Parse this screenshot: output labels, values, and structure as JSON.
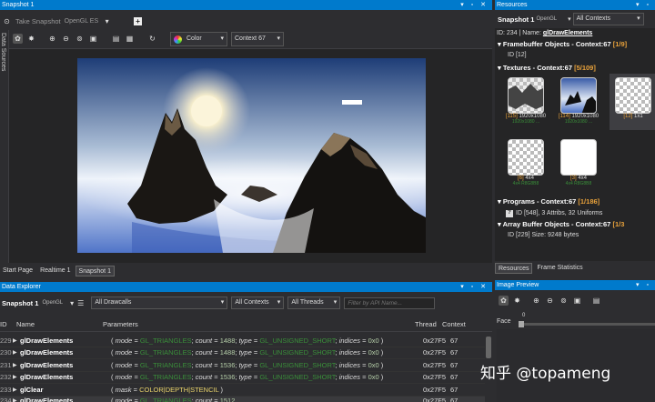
{
  "snapshot_panel": {
    "title": "Snapshot 1",
    "take_snapshot": "Take Snapshot",
    "api": "OpenGL ES",
    "color_label": "Color",
    "context_label": "Context 67",
    "side_tab": "Data Sources",
    "tabs": [
      "Start Page",
      "Realtime 1",
      "Snapshot 1"
    ]
  },
  "resources": {
    "title": "Resources",
    "snapshot_label": "Snapshot 1",
    "snapshot_api": "OpenGL",
    "contexts_filter": "All Contexts",
    "id_line": "ID: 234 | Name: ",
    "id_name": "glDrawElements",
    "fbo_label": "Framebuffer Objects - Context:67 ",
    "fbo_count": "[1/9]",
    "fbo_item": "ID [12]",
    "tex_label": "Textures - Context:67 ",
    "tex_count": "[5/109]",
    "textures": [
      {
        "id": "[115]",
        "size": "1920x1080",
        "sub": "1920x1080 ..."
      },
      {
        "id": "[114]",
        "size": "1920x1080",
        "sub": "1920x1080 ..."
      },
      {
        "id": "[12]",
        "size": "1x1",
        "sub": ""
      },
      {
        "id": "[6]",
        "size": "4x4",
        "sub": "4x4 R8G8B8"
      },
      {
        "id": "[3]",
        "size": "4x4",
        "sub": "4x4 R8G8B8"
      }
    ],
    "prog_label": "Programs - Context:67 ",
    "prog_count": "[1/186]",
    "prog_item": "ID [548], 3 Attribs, 32 Uniforms",
    "abo_label": "Array Buffer Objects - Context:67 ",
    "abo_count": "[1/3",
    "abo_item": "ID [229] Size: 9248 bytes",
    "tabs": [
      "Resources",
      "Frame Statistics"
    ]
  },
  "explorer": {
    "title": "Data Explorer",
    "snapshot_label": "Snapshot 1",
    "snapshot_api": "OpenGL",
    "drawcalls_filter": "All Drawcalls",
    "contexts_filter": "All Contexts",
    "threads_filter": "All Threads",
    "filter_placeholder": "Filter by API Name...",
    "headers": {
      "id": "ID",
      "name": "Name",
      "params": "Parameters",
      "thread": "Thread",
      "context": "Context"
    },
    "rows": [
      {
        "id": "229",
        "name": "glDrawElements",
        "mode": "GL_TRIANGLES",
        "count": "1488",
        "type": "GL_UNSIGNED_SHORT",
        "indices": "0x0",
        "thread": "0x27F5",
        "context": "67"
      },
      {
        "id": "230",
        "name": "glDrawElements",
        "mode": "GL_TRIANGLES",
        "count": "1488",
        "type": "GL_UNSIGNED_SHORT",
        "indices": "0x0",
        "thread": "0x27F5",
        "context": "67"
      },
      {
        "id": "231",
        "name": "glDrawElements",
        "mode": "GL_TRIANGLES",
        "count": "1536",
        "type": "GL_UNSIGNED_SHORT",
        "indices": "0x0",
        "thread": "0x27F5",
        "context": "67"
      },
      {
        "id": "232",
        "name": "glDrawElements",
        "mode": "GL_TRIANGLES",
        "count": "1536",
        "type": "GL_UNSIGNED_SHORT",
        "indices": "0x0",
        "thread": "0x27F5",
        "context": "67"
      }
    ],
    "clear_row": {
      "id": "233",
      "name": "glClear",
      "mask": "COLOR|DEPTH|STENCIL",
      "thread": "0x27F5",
      "context": "67"
    },
    "partial_row": {
      "id": "234",
      "name": "glDrawElements",
      "mode": "GL_TRIANGLES",
      "count": "1512",
      "thread": "0x27F5",
      "context": "67"
    }
  },
  "preview": {
    "title": "Image Preview",
    "face_label": "Face",
    "face_value": "0"
  },
  "watermark": "知乎 @topameng"
}
